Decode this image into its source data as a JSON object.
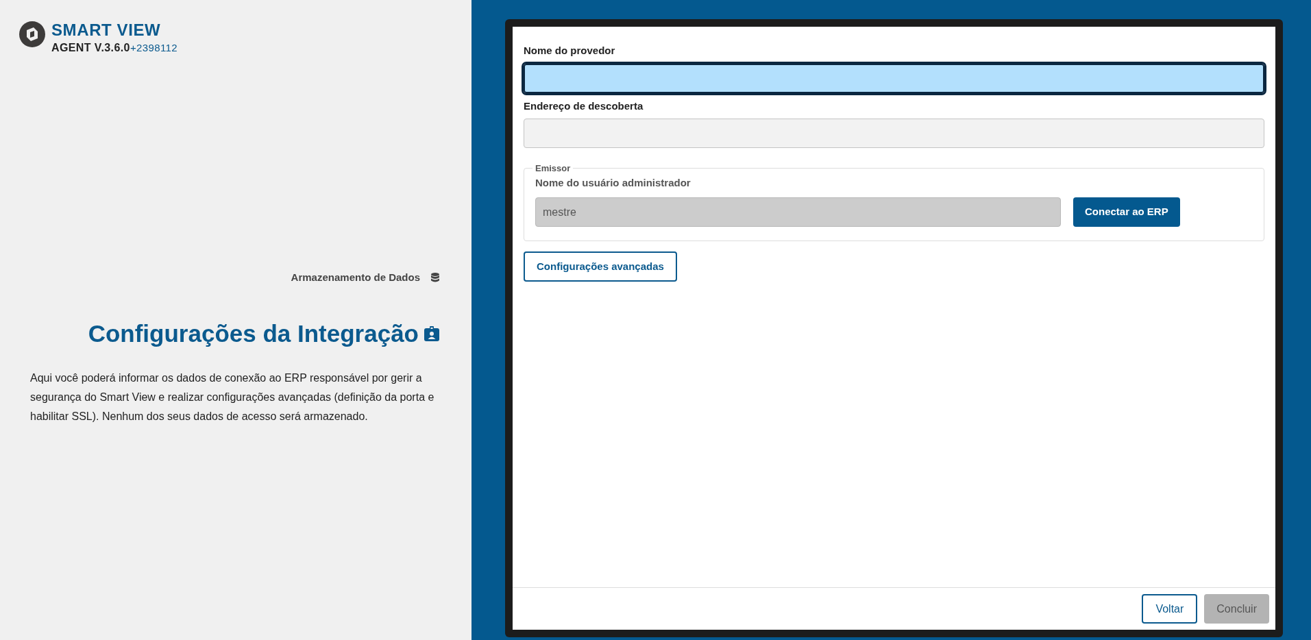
{
  "brand": {
    "title": "SMART VIEW",
    "subtitle": "AGENT V.3.6.0",
    "build": "+2398112"
  },
  "storage_link": "Armazenamento de Dados",
  "heading": "Configurações da Integração",
  "description": "Aqui você poderá informar os dados de conexão ao ERP responsável por gerir a segurança do Smart View e realizar configurações avançadas (definição da porta e habilitar SSL). Nenhum dos seus dados de acesso será armazenado.",
  "form": {
    "fields": [
      {
        "label": "Nome do provedor",
        "focused": true,
        "disabled": false
      },
      {
        "label": "Endereço de descoberta",
        "focused": false,
        "disabled": true
      }
    ],
    "issuer": {
      "legend": "Emissor",
      "label": "Nome do usuário administrador",
      "value": "mestre",
      "disabled": true,
      "button": "Conectar ao ERP"
    },
    "advanced_button": "Configurações avançadas"
  },
  "footer": [
    {
      "label": "Voltar",
      "disabled": false
    },
    {
      "label": "Concluir",
      "disabled": true
    }
  ]
}
